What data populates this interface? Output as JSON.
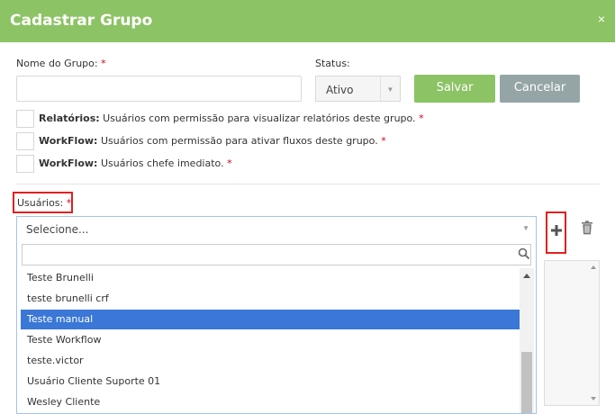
{
  "dialog": {
    "title": "Cadastrar Grupo",
    "close_symbol": "×"
  },
  "form": {
    "group_name_label": "Nome do Grupo:",
    "group_name_value": "",
    "required_mark": "*",
    "status_label": "Status:",
    "status_value": "Ativo",
    "save_label": "Salvar",
    "cancel_label": "Cancelar"
  },
  "permissions": [
    {
      "bold": "Relatórios:",
      "text": " Usuários com permissão para visualizar relatórios deste grupo.",
      "checked": false
    },
    {
      "bold": "WorkFlow:",
      "text": " Usuários com permissão para ativar fluxos deste grupo.",
      "checked": false
    },
    {
      "bold": "WorkFlow:",
      "text": " Usuários chefe imediato.",
      "checked": false
    }
  ],
  "users": {
    "label": "Usuários:",
    "select_placeholder": "Selecione...",
    "search_value": "",
    "options": [
      {
        "label": "Teste Brunelli",
        "selected": false
      },
      {
        "label": "teste brunelli crf",
        "selected": false
      },
      {
        "label": "Teste manual",
        "selected": true
      },
      {
        "label": "Teste Workflow",
        "selected": false
      },
      {
        "label": "teste.victor",
        "selected": false
      },
      {
        "label": "Usuário Cliente Suporte 01",
        "selected": false
      },
      {
        "label": "Wesley Cliente",
        "selected": false
      }
    ],
    "add_icon": "plus-icon",
    "remove_icon": "trash-icon"
  },
  "colors": {
    "header": "#8cc364",
    "save_button": "#8cc364",
    "cancel_button": "#95a5a6",
    "selected_option": "#3a77d6",
    "highlight_border": "#e02020",
    "required": "#d0021b"
  }
}
